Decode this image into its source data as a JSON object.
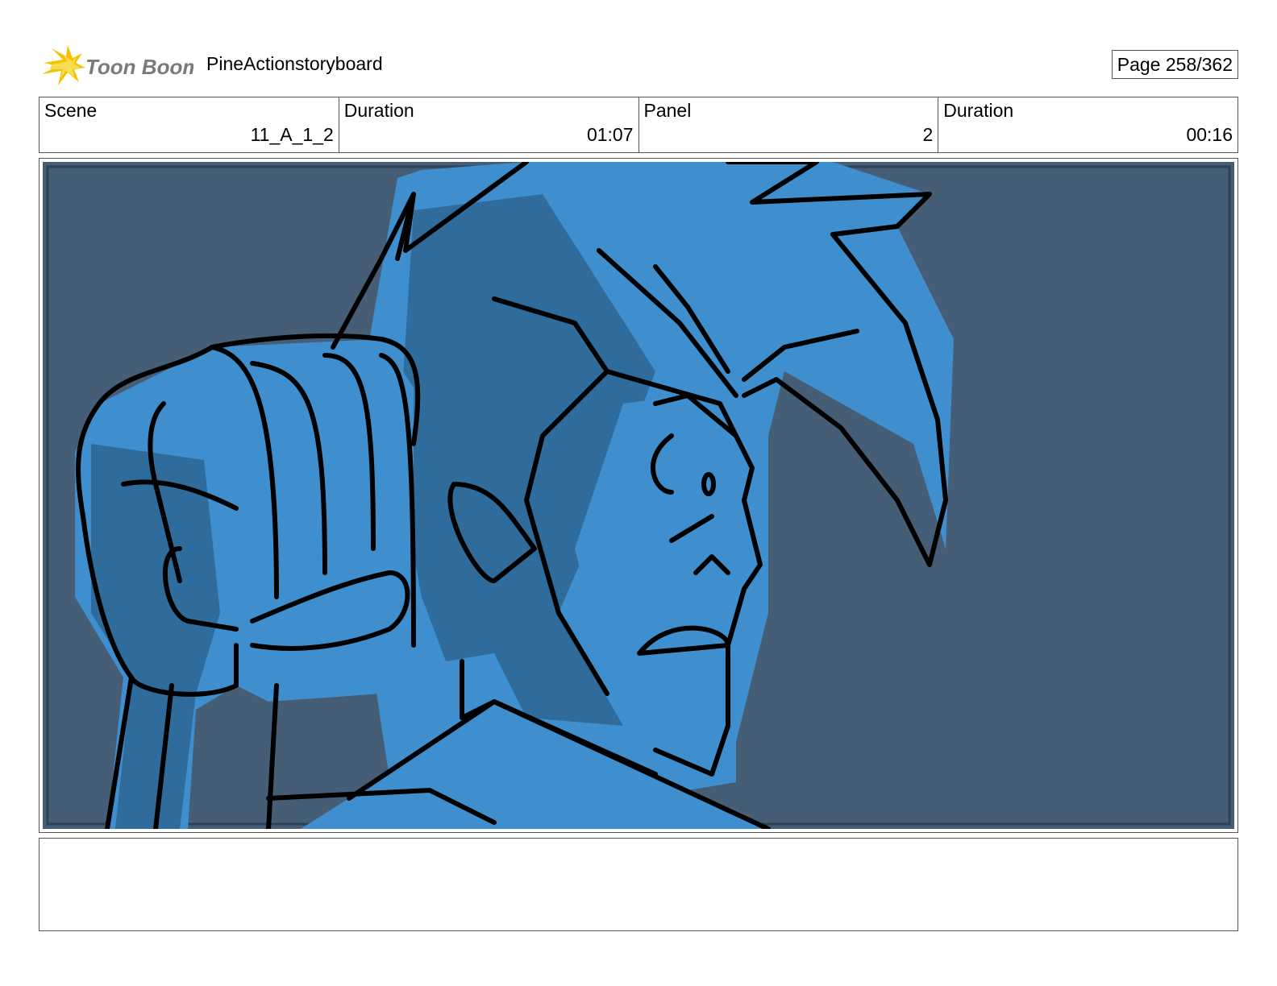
{
  "header": {
    "logo_text": "Toon Boom",
    "project_title": "PineActionstoryboard",
    "page_label": "Page 258/362"
  },
  "info": {
    "scene_label": "Scene",
    "scene_value": "11_A_1_2",
    "scene_duration_label": "Duration",
    "scene_duration_value": "01:07",
    "panel_label": "Panel",
    "panel_value": "2",
    "panel_duration_label": "Duration",
    "panel_duration_value": "00:16"
  },
  "colors": {
    "background_panel": "#465e75",
    "character_fill": "#3f8fcf",
    "character_shadow": "#2f6c9c",
    "line": "#000000"
  },
  "notes": {
    "text": ""
  }
}
